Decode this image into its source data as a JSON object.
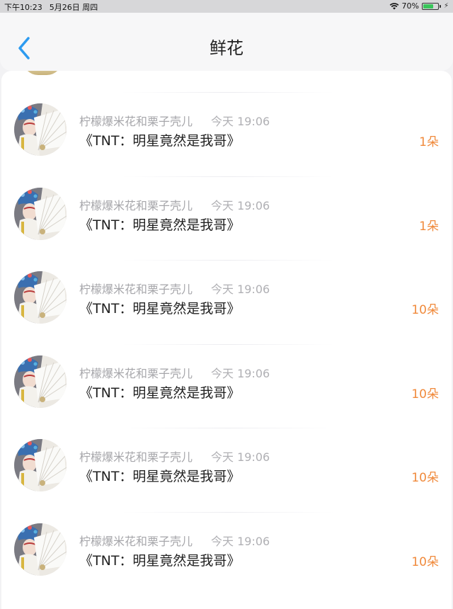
{
  "status_bar": {
    "time": "下午10:23",
    "date": "5月26日 周四",
    "battery": "70%",
    "battery_level": 0.7,
    "battery_color": "#39c55a"
  },
  "nav": {
    "title": "鲜花",
    "back_icon": "chevron-left-icon",
    "accent": "#2d9bf0"
  },
  "items": [
    {
      "name": "柠檬爆米花和栗子壳儿",
      "time": "今天 19:06",
      "title": "《TNT：明星竟然是我哥》",
      "count": "1朵"
    },
    {
      "name": "柠檬爆米花和栗子壳儿",
      "time": "今天 19:06",
      "title": "《TNT：明星竟然是我哥》",
      "count": "1朵"
    },
    {
      "name": "柠檬爆米花和栗子壳儿",
      "time": "今天 19:06",
      "title": "《TNT：明星竟然是我哥》",
      "count": "10朵"
    },
    {
      "name": "柠檬爆米花和栗子壳儿",
      "time": "今天 19:06",
      "title": "《TNT：明星竟然是我哥》",
      "count": "10朵"
    },
    {
      "name": "柠檬爆米花和栗子壳儿",
      "time": "今天 19:06",
      "title": "《TNT：明星竟然是我哥》",
      "count": "10朵"
    },
    {
      "name": "柠檬爆米花和栗子壳儿",
      "time": "今天 19:06",
      "title": "《TNT：明星竟然是我哥》",
      "count": "10朵"
    }
  ],
  "count_color": "#f08a3c"
}
